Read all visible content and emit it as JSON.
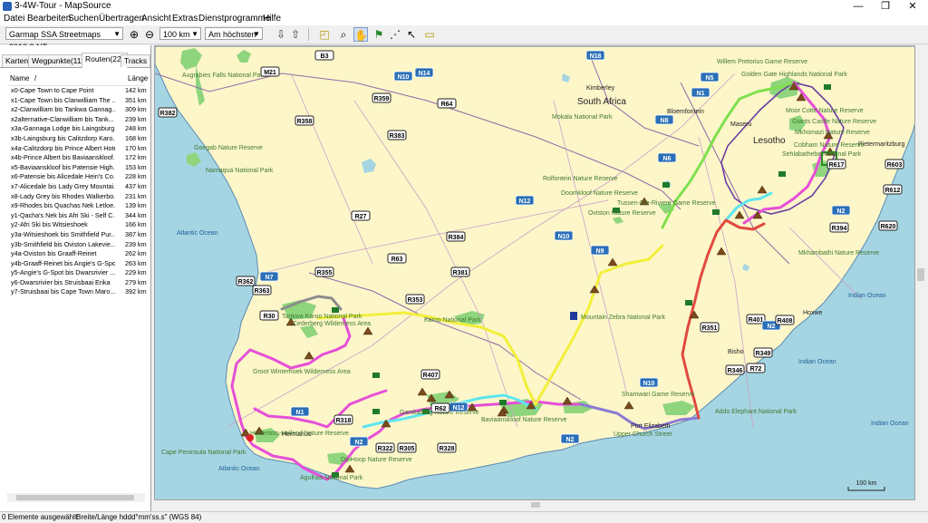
{
  "window": {
    "title": "3-4W-Tour - MapSource",
    "minimize": "—",
    "maximize": "❐",
    "close": "✕"
  },
  "menu": [
    "Datei",
    "Bearbeiten",
    "Suchen",
    "Übertragen",
    "Ansicht",
    "Extras",
    "Dienstprogramme",
    "Hilfe"
  ],
  "toolbar": {
    "map_product": "Garmap SSA Streetmaps 2013.2 NT",
    "zoom_level": "100 km",
    "detail": "Am höchsten"
  },
  "tabs": [
    "Karten",
    "Wegpunkte(111)",
    "Routen(22)",
    "Tracks"
  ],
  "active_tab": "Routen(22)",
  "columns": {
    "name": "Name",
    "sort": "/",
    "length": "Länge"
  },
  "routes": [
    {
      "name": "x0-Cape Town to Cape Point",
      "length": "142 km"
    },
    {
      "name": "x1-Cape Town bis Clanwilliam The ...",
      "length": "351 km"
    },
    {
      "name": "x2-Clanwilliam bis Tankwa Gannag...",
      "length": "309 km"
    },
    {
      "name": "x2alternative-Clanwilliam bis Tank...",
      "length": "239 km"
    },
    {
      "name": "x3a-Gannaga Lodge bis Laingsburg...",
      "length": "248 km"
    },
    {
      "name": "x3b-Laingsburg bis Calitzdorp Karo...",
      "length": "168 km"
    },
    {
      "name": "x4a-Calitzdorp bis Prince Albert Hotel",
      "length": "170 km"
    },
    {
      "name": "x4b-Prince Albert bis Baviaanskloof...",
      "length": "172 km"
    },
    {
      "name": "x5-Baviaanskloof bis Patensie High...",
      "length": "153 km"
    },
    {
      "name": "x6-Patensie bis Alicedale Hein's Co...",
      "length": "228 km"
    },
    {
      "name": "x7-Alicedale bis Lady Grey Mountai...",
      "length": "437 km"
    },
    {
      "name": "x8-Lady Grey bis Rhodes Walkerbo...",
      "length": "231 km"
    },
    {
      "name": "x9-Rhodes bis Quachas Nek Letloe...",
      "length": "139 km"
    },
    {
      "name": "y1-Qacha's Nek bis Afri Ski - Self C...",
      "length": "344 km"
    },
    {
      "name": "y2-Afri Ski bis Witsieshoek",
      "length": "166 km"
    },
    {
      "name": "y3a-Witsieshoek bis Smithfield Pur...",
      "length": "387 km"
    },
    {
      "name": "y3b-Smithfield bis Oviston Lakevie...",
      "length": "239 km"
    },
    {
      "name": "y4a-Oviston bis Graaff-Reinet",
      "length": "262 km"
    },
    {
      "name": "y4b-Graaff-Reinet bis Angie's G-Spot",
      "length": "263 km"
    },
    {
      "name": "y5-Angie's G-Spot bis Dwarsrivier ...",
      "length": "229 km"
    },
    {
      "name": "y6-Dwarsrivier bis Struisbaai Erika",
      "length": "279 km"
    },
    {
      "name": "y7-Struisbaai bis Cape Town Maro...",
      "length": "392 km"
    }
  ],
  "status": {
    "selection": "0 Elemente ausgewählt",
    "coords": "Breite/Länge hddd°mm'ss.s\" (WGS 84)"
  },
  "map": {
    "countries": [
      "South Africa",
      "Lesotho"
    ],
    "oceans": [
      "Atlantic Ocean",
      "Atlantic Ocean",
      "Indian Ocean",
      "Indian Ocean",
      "Indian Ocean"
    ],
    "places": [
      "Kimberley",
      "Bloemfontein",
      "Maseru",
      "Pietermaritzburg",
      "Port Elizabeth",
      "Bisho",
      "Hoxwe",
      "Hermanus"
    ],
    "parks": [
      "Augrabies Falls National Park",
      "Namaqua National Park",
      "Goegab Nature Reserve",
      "Mokala National Park",
      "Willem Pretorius Game Reserve",
      "Golden Gate Highlands National Park",
      "Moor Cotte Nature Reserve",
      "Giants Castle Nature Reserve",
      "Mkhomazi Nature Reserve",
      "Cobham Nature Reserve",
      "Sehlabathebe National Park",
      "Rolfontein Nature Reserve",
      "Doornkloof Nature Reserve",
      "Tussen-Die-Riviere Game Reserve",
      "Oviston Nature Reserve",
      "Mountain Zebra National Park",
      "Karoo National Park",
      "Tankwa Karoo National Park",
      "Cederberg Wilderness Area",
      "Groot Winterhoek Wilderness Area",
      "Gamkaberg Nature Reserve",
      "Baviaanskloof Nature Reserve",
      "Shamwari Game Reserve",
      "Addo Elephant National Park",
      "Mkhambathi Nature Reserve",
      "Cape Peninsula National Park",
      "Agulhas National Park",
      "De Hoop Nature Reserve",
      "Hottentots-Holland Nature Reserve",
      "Upper Church Street"
    ],
    "road_shields": [
      "B3",
      "M21",
      "N10",
      "N14",
      "R359",
      "R64",
      "R382",
      "R358",
      "R383",
      "N18",
      "N5",
      "N1",
      "N8",
      "N6",
      "R612",
      "R603",
      "R617",
      "R394",
      "R620",
      "N2",
      "N12",
      "N10",
      "N9",
      "R384",
      "R27",
      "R63",
      "R381",
      "R355",
      "R362",
      "R363",
      "N7",
      "R353",
      "R30",
      "N1",
      "R407",
      "N12",
      "R62",
      "R318",
      "R322",
      "R305",
      "R328",
      "N2",
      "N2",
      "N10",
      "R351",
      "R401",
      "N2",
      "R408",
      "R349",
      "R72",
      "R346"
    ],
    "scale": "100 km"
  },
  "colors": {
    "land": "#fdf6c9",
    "water": "#a5d5e3",
    "park": "#8fd57d",
    "route_magenta": "#e64fd8",
    "route_green": "#7ee04d",
    "route_yellow": "#f2ef3a",
    "route_cyan": "#5ee5f0",
    "route_red": "#e14a3f",
    "route_purple": "#8c7ad6",
    "route_grey": "#8c8c8c"
  }
}
